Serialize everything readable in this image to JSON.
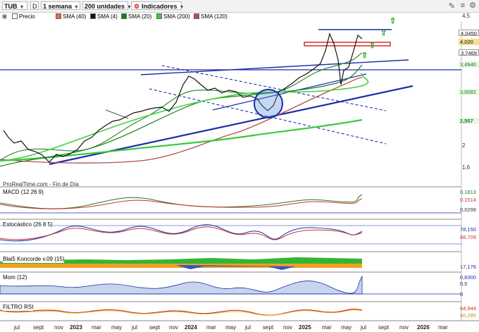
{
  "toolbar": {
    "symbol": "TUB",
    "mode": "D",
    "period": "1 semana",
    "units": "200 unidades",
    "indicators": "Indicadores"
  },
  "legend": {
    "price": "Precio",
    "sma40": "SMA (40)",
    "sma4": "SMA (4)",
    "sma20": "SMA (20)",
    "sma200": "SMA (200)",
    "sma120": "SMA (120)"
  },
  "price_axis": {
    "ticks": [
      "4,5",
      "2",
      "1,6"
    ],
    "tags": [
      "4,0450",
      "4,020",
      "3,7469",
      "3,4946",
      "3,0082",
      "2,507"
    ]
  },
  "watermark": "ProRealTime.com - Fin de Día",
  "panels": {
    "macd": {
      "label": "MACD (12 26 9)",
      "tags": [
        "0,1813",
        "0,1514",
        "0,0299"
      ]
    },
    "stoch": {
      "label": "Estocástico (26 8 5)",
      "tags": [
        "78,150",
        "68,709"
      ]
    },
    "blai": {
      "label": "Blai5 Koncorde v.09 (15)",
      "tags": [
        "17,176"
      ]
    },
    "mom": {
      "label": "Mom (12)",
      "tags": [
        "0,8300",
        "0,5",
        "0"
      ]
    },
    "rsi": {
      "label": "FILTRO RSI",
      "tags": [
        "64,944",
        "60,285"
      ]
    }
  },
  "x_axis": [
    "jul",
    "sept",
    "nov",
    "2023",
    "mar",
    "may",
    "jul",
    "sept",
    "nov",
    "2024",
    "mar",
    "may",
    "jul",
    "sept",
    "nov",
    "2025",
    "mar",
    "may",
    "jul",
    "sept",
    "nov",
    "2026",
    "mar"
  ],
  "colors": {
    "sma40": "#1a7d1a",
    "sma4": "#111111",
    "sma20": "#2e8b2e",
    "sma200": "#3cc83c",
    "sma120": "#b05050",
    "trend": "#1a2ea8",
    "resistance": "#d22020"
  }
}
